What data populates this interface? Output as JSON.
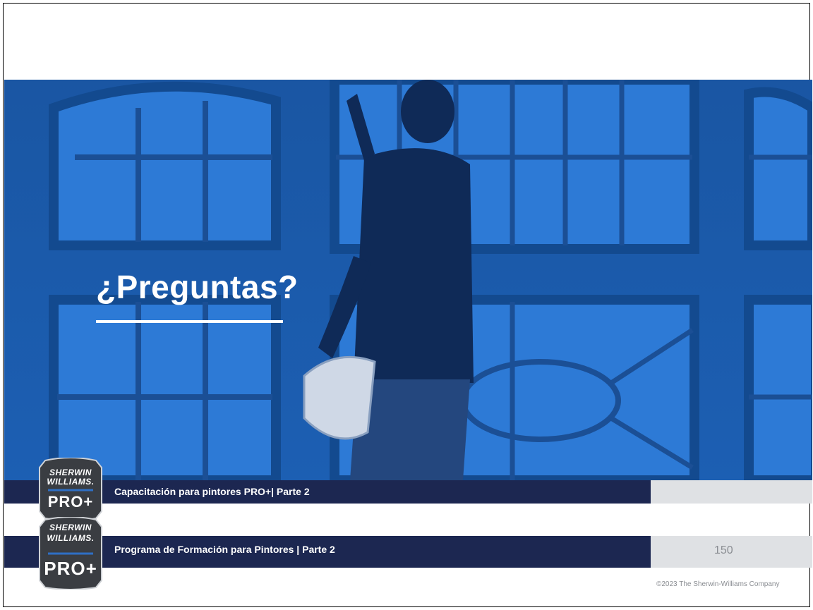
{
  "slide": {
    "title": "¿Preguntas?",
    "footer_primary": "Capacitación para pintores PRO+|  Parte 2",
    "footer_secondary": "Programa de Formación para Pintores |  Parte 2",
    "page_number": "150",
    "copyright": "©2023 The Sherwin-Williams Company"
  },
  "logo": {
    "line1": "SHERWIN",
    "line2": "WILLIAMS.",
    "line3": "PRO+"
  },
  "colors": {
    "hero_blue": "#1d5fb0",
    "navy": "#1c2751",
    "gray_panel": "#dfe1e4",
    "logo_dark": "#3a3d42"
  },
  "hero_image": {
    "icon": "painter-at-window-photo"
  }
}
